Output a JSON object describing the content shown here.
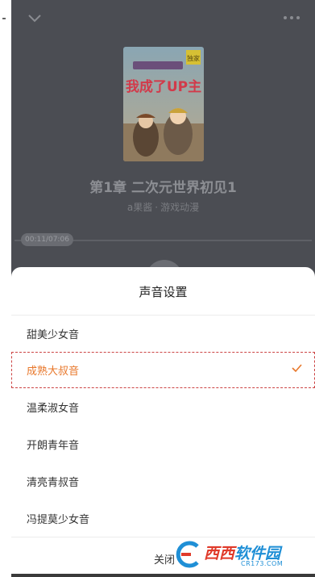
{
  "player": {
    "chapter_title": "第1章  二次元世界初见1",
    "author": "a果酱",
    "separator": "·",
    "category": "游戏动漫",
    "elapsed": "00:11",
    "duration": "07:06",
    "cover": {
      "title_text": "我成了UP主",
      "badge_text": "独家"
    }
  },
  "voice_settings": {
    "title": "声音设置",
    "options": [
      {
        "label": "甜美少女音",
        "selected": false
      },
      {
        "label": "成熟大叔音",
        "selected": true
      },
      {
        "label": "温柔淑女音",
        "selected": false
      },
      {
        "label": "开朗青年音",
        "selected": false
      },
      {
        "label": "清亮青叔音",
        "selected": false
      },
      {
        "label": "冯提莫少女音",
        "selected": false
      }
    ],
    "close_label": "关闭"
  },
  "watermark": {
    "name_part1": "西西",
    "name_part2": "软件园",
    "url": "CR173.COM"
  },
  "colors": {
    "accent": "#e8772a",
    "player_bg": "#4b4d53",
    "sheet_bg": "#ffffff"
  }
}
